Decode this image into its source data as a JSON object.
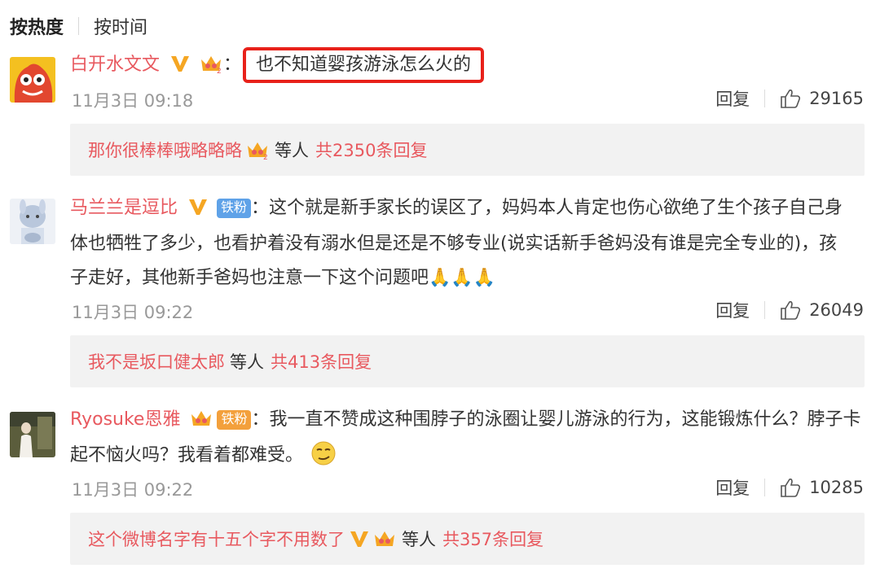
{
  "sort": {
    "hot": "按热度",
    "time": "按时间"
  },
  "comments": [
    {
      "username": "白开水文文",
      "colon": "：",
      "text": "也不知道婴孩游泳怎么火的",
      "time": "11月3日 09:18",
      "reply_label": "回复",
      "likes": "29165",
      "sub_reply_user": "那你很棒棒哦略略略",
      "others": "等人",
      "total": "共2350条回复"
    },
    {
      "username": "马兰兰是逗比",
      "fan_badge": "铁粉",
      "colon": "：",
      "text_line1": "这个就是新手家长的误区了，妈妈本人肯定也伤心欲绝了生个孩子自己身",
      "text_line2": "体也牺牲了多少，也看护着没有溺水但是还是不够专业(说实话新手爸妈没有谁是完全专业的)，孩",
      "text_line3": "子走好，其他新手爸妈也注意一下这个问题吧🙏🙏🙏",
      "time": "11月3日 09:22",
      "reply_label": "回复",
      "likes": "26049",
      "sub_reply_user": "我不是坂口健太郎",
      "others": "等人",
      "total": "共413条回复"
    },
    {
      "username": "Ryosuke恩雅",
      "fan_badge": "铁粉",
      "colon": "：",
      "text_line1": "我一直不赞成这种围脖子的泳圈让婴儿游泳的行为，这能锻炼什么？脖子卡",
      "text_line2": "起不恼火吗？我看着都难受。",
      "time": "11月3日 09:22",
      "reply_label": "回复",
      "likes": "10285",
      "sub_reply_user": "这个微博名字有十五个字不用数了",
      "others": "等人",
      "total": "共357条回复"
    }
  ],
  "colors": {
    "username": "#e8595f",
    "highlight_border": "#e8211a",
    "reply_bg": "#f2f2f2",
    "vip": "#f5a623",
    "fan_blue": "#5fa2e8",
    "fan_orange": "#f3a03c"
  }
}
